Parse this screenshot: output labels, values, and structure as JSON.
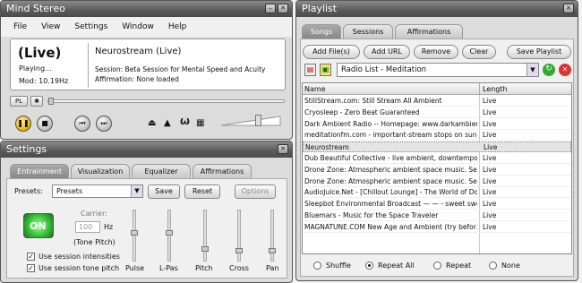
{
  "player": {
    "title": "Mind Stereo",
    "menu": [
      "File",
      "View",
      "Settings",
      "Window",
      "Help"
    ],
    "live_label": "(Live)",
    "stream_name": "Neurostream (Live)",
    "status": "Playing...",
    "mod": "Mod: 10.19Hz",
    "session": "Session: Beta Session for Mental Speed and Acuity",
    "affirmation": "Affirmation: None loaded",
    "pl_label": "PL",
    "star_label": "✱"
  },
  "settings": {
    "title": "Settings",
    "tabs": [
      "Entrainment",
      "Visualization",
      "Equalizer",
      "Affirmations"
    ],
    "presets_label": "Presets:",
    "presets_value": "Presets",
    "save": "Save",
    "reset": "Reset",
    "options": "Options",
    "on": "ON",
    "carrier_label": "Carrier:",
    "carrier_value": "100",
    "hz": "Hz",
    "tone_pitch": "(Tone Pitch)",
    "check1": "Use session intensities",
    "check2": "Use session tone pitch",
    "sliders": [
      "Pulse",
      "L-Pas",
      "Pitch",
      "Cross",
      "Pan"
    ]
  },
  "playlist": {
    "title": "Playlist",
    "tabs": [
      "Songs",
      "Sessions",
      "Affirmations"
    ],
    "buttons": [
      "Add File(s)",
      "Add URL",
      "Remove",
      "Clear",
      "Save Playlist"
    ],
    "list_name": "Radio List - Meditation",
    "col_name": "Name",
    "col_length": "Length",
    "rows": [
      {
        "name": "StillStream.com: Still Stream All Ambient",
        "length": "Live"
      },
      {
        "name": "Cryosleep - Zero Beat Guaranteed",
        "length": "Live"
      },
      {
        "name": "Dark Ambient Radio -- Homepage: www.darkambient…",
        "length": "Live"
      },
      {
        "name": "meditationfm.com - important-stream stops on sunda…",
        "length": "Live"
      },
      {
        "name": "Neurostream",
        "length": "Live"
      },
      {
        "name": "Dub Beautiful Collective - live ambient, downtempo, a…",
        "length": "Live"
      },
      {
        "name": "Drone Zone: Atmospheric ambient space music. Serv…",
        "length": "Live"
      },
      {
        "name": "Drone Zone: Atmospheric ambient space music. Serv…",
        "length": "Live"
      },
      {
        "name": "AudioJuice.Net - [Chillout Lounge] - The World of Do…",
        "length": "Live"
      },
      {
        "name": "Sleepbot Environmental Broadcast — — - sweet swe…",
        "length": "Live"
      },
      {
        "name": "Bluemars - Music for the Space Traveler",
        "length": "Live"
      },
      {
        "name": "MAGNATUNE.COM New Age and Ambient (try befor…",
        "length": "Live"
      }
    ],
    "radios": [
      "Shuffle",
      "Repeat All",
      "Repeat",
      "None"
    ]
  }
}
